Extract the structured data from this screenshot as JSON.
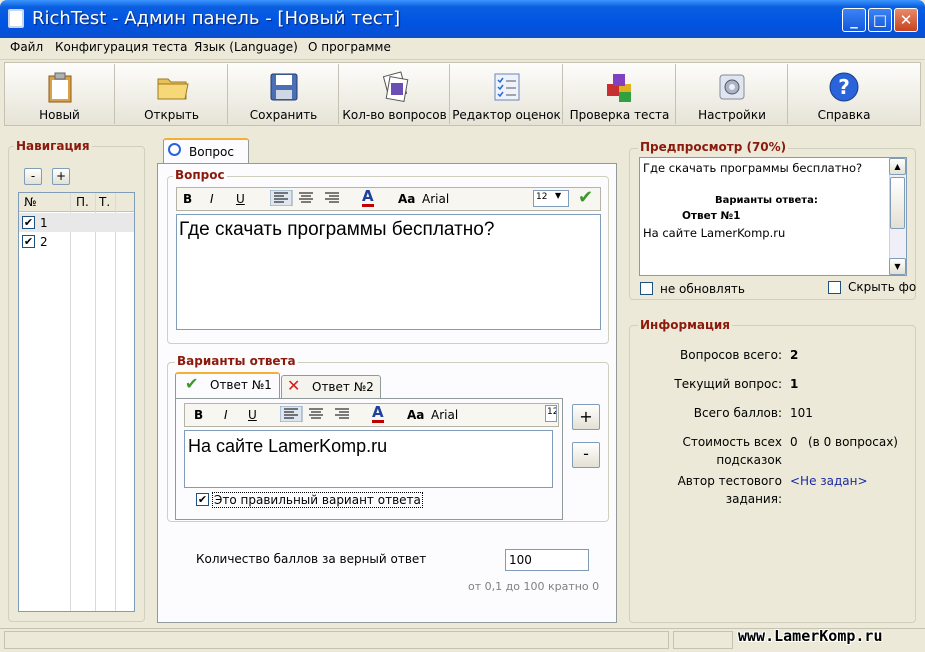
{
  "window": {
    "title": "RichTest - Админ панель - [Новый тест]"
  },
  "menu": [
    "Файл",
    "Конфигурация теста",
    "Язык (Language)",
    "О программе"
  ],
  "toolbar": {
    "new": "Новый",
    "open": "Открыть",
    "save": "Сохранить",
    "count": "Кол-во вопросов",
    "grades": "Редактор оценок",
    "check": "Проверка теста",
    "settings": "Настройки",
    "help": "Справка"
  },
  "navigation": {
    "title": "Навигация",
    "minus": "-",
    "plus": "+",
    "columns": [
      "№",
      "П.",
      "Т."
    ],
    "rows": [
      {
        "num": "1",
        "checked": true
      },
      {
        "num": "2",
        "checked": true
      }
    ]
  },
  "tab": {
    "label": "Вопрос"
  },
  "question": {
    "title": "Вопрос",
    "bold": "B",
    "italic": "I",
    "underline": "U",
    "font_prefix": "Aa",
    "font": "Arial",
    "size": "12",
    "text": "Где скачать программы бесплатно?"
  },
  "answers": {
    "title": "Варианты ответа",
    "tabs": [
      "Ответ №1",
      "Ответ №2"
    ],
    "text": "На сайте LamerKomp.ru",
    "correct_label": "Это правильный вариант ответа",
    "correct_checked": true,
    "add": "+",
    "remove": "-",
    "size_partial": "12"
  },
  "score": {
    "label": "Количество баллов за верный ответ",
    "value": "100",
    "hint": "от 0,1 до 100 кратно 0"
  },
  "preview": {
    "title": "Предпросмотр (70%)",
    "question": "Где скачать программы бесплатно?",
    "variants_heading": "Варианты ответа:",
    "answer_heading": "Ответ №1",
    "answer_text": "На сайте LamerKomp.ru",
    "no_update": "не обновлять",
    "hide": "Скрыть фо"
  },
  "info": {
    "title": "Информация",
    "total_q_label": "Вопросов всего:",
    "total_q": "2",
    "current_label": "Текущий вопрос:",
    "current": "1",
    "points_label": "Всего баллов:",
    "points": "101",
    "hint_cost_label1": "Стоимость всех",
    "hint_cost_label2": "подсказок",
    "hint_cost": "0",
    "hint_cost_note": "(в 0 вопросах)",
    "author_label1": "Автор тестового",
    "author_label2": "задания:",
    "author": "<Не задан>"
  },
  "watermark": "www.LamerKomp.ru"
}
